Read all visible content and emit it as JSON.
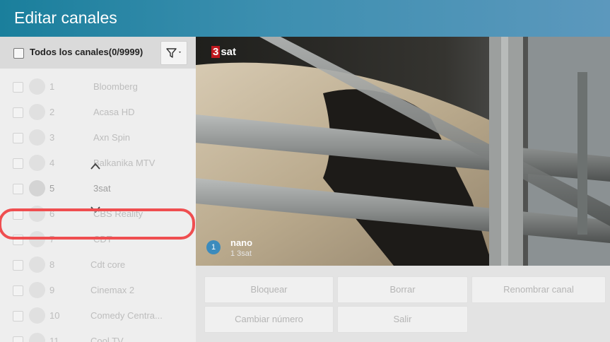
{
  "header": {
    "title": "Editar canales"
  },
  "list_header": {
    "all_label": "Todos los canales(0/9999)",
    "filter_icon": "filter-icon"
  },
  "channels": [
    {
      "num": "1",
      "name": "Bloomberg"
    },
    {
      "num": "2",
      "name": "Acasa HD"
    },
    {
      "num": "3",
      "name": "Axn Spin"
    },
    {
      "num": "4",
      "name": "Balkanika MTV"
    },
    {
      "num": "5",
      "name": "3sat"
    },
    {
      "num": "6",
      "name": "CBS Reality"
    },
    {
      "num": "7",
      "name": "CDT"
    },
    {
      "num": "8",
      "name": "Cdt core"
    },
    {
      "num": "9",
      "name": "Cinemax 2"
    },
    {
      "num": "10",
      "name": "Comedy Centra..."
    },
    {
      "num": "11",
      "name": "Cool TV"
    }
  ],
  "selected_channel": "5",
  "preview": {
    "logo_three": "3",
    "logo_rest": "sat",
    "badge": "1",
    "program_title": "nano",
    "program_channel": "1  3sat"
  },
  "actions": {
    "block": "Bloquear",
    "delete": "Borrar",
    "rename": "Renombrar canal",
    "change_number": "Cambiar número",
    "exit": "Salir"
  },
  "colors": {
    "header": "#1a7f9c",
    "highlight": "#ef4e50",
    "badge": "#3c8bbd",
    "logo_red": "#c0181f"
  }
}
